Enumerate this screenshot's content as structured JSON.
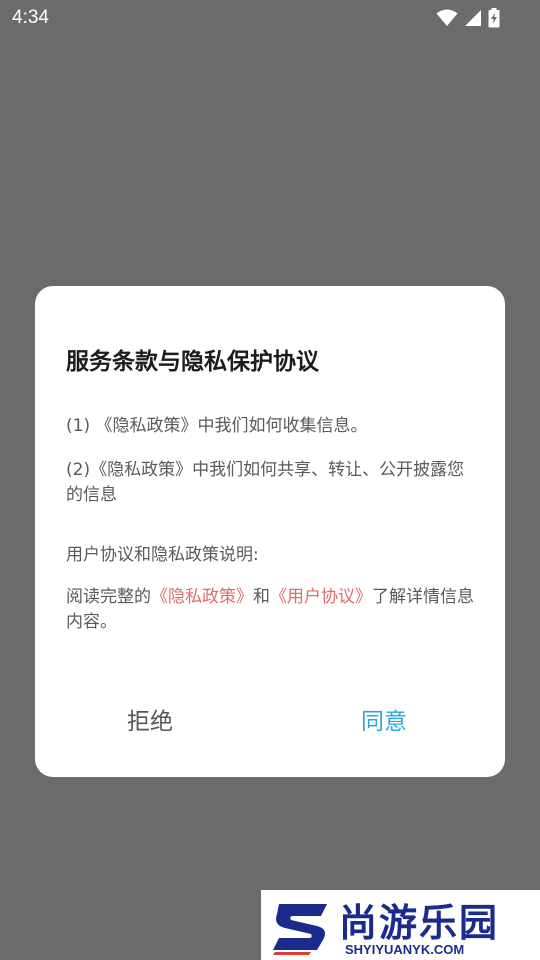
{
  "status_bar": {
    "time": "4:34",
    "icons": [
      "wifi-icon",
      "signal-icon",
      "battery-charging-icon"
    ]
  },
  "dialog": {
    "title": "服务条款与隐私保护协议",
    "item1": "(1) 《隐私政策》中我们如何收集信息。",
    "item2": "(2)《隐私政策》中我们如何共享、转让、公开披露您的信息",
    "section_heading": "用户协议和隐私政策说明:",
    "read_prefix": "阅读完整的",
    "privacy_link": "《隐私政策》",
    "conjunction": "和",
    "user_agreement_link": "《用户协议》",
    "read_suffix": "了解详情信息内容。",
    "refuse_button": "拒绝",
    "agree_button": "同意"
  },
  "colors": {
    "overlay": "#6b6b6b",
    "link": "#e06b6b",
    "agree": "#2aa8d8",
    "watermark": "#1b2b8c"
  },
  "watermark": {
    "text": "尚游乐园",
    "url": "SHYIYUANYK.COM"
  }
}
